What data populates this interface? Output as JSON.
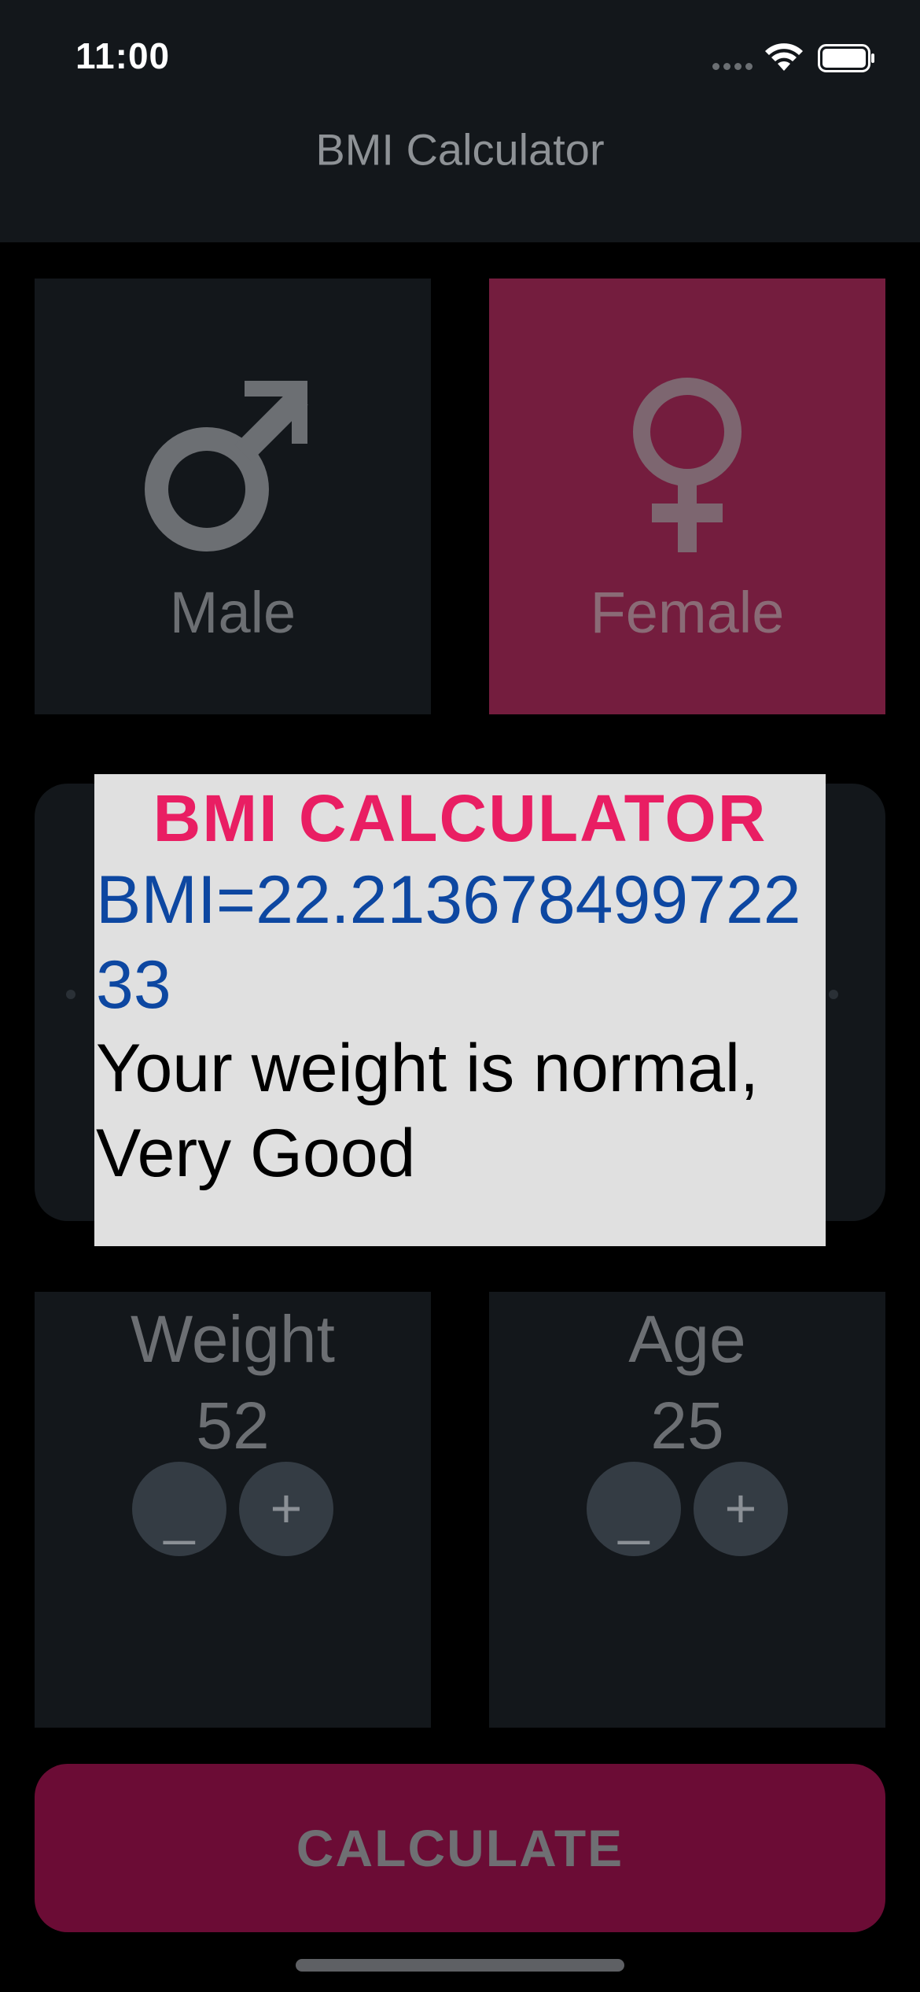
{
  "status_bar": {
    "time": "11:00"
  },
  "app_bar": {
    "title": "BMI Calculator"
  },
  "gender": {
    "male_label": "Male",
    "female_label": "Female",
    "selected": "Female"
  },
  "weight": {
    "label": "Weight",
    "value": "52",
    "minus": "_",
    "plus": "+"
  },
  "age": {
    "label": "Age",
    "value": "25",
    "minus": "_",
    "plus": "+"
  },
  "dialog": {
    "title": "BMI CALCULATOR",
    "bmi_text": "BMI=22.21367849972233",
    "message": "Your weight is normal, Very Good"
  },
  "calculate_button": {
    "label": "CALCULATE"
  },
  "colors": {
    "background": "#000000",
    "card": "#13171b",
    "selected_card": "#741d3e",
    "accent": "#e91e63",
    "calculate": "#6b0c35",
    "bmi_text": "#0d47a1"
  },
  "icons": {
    "male": "male-symbol-icon",
    "female": "female-symbol-icon",
    "wifi": "wifi-icon",
    "battery": "battery-icon"
  }
}
